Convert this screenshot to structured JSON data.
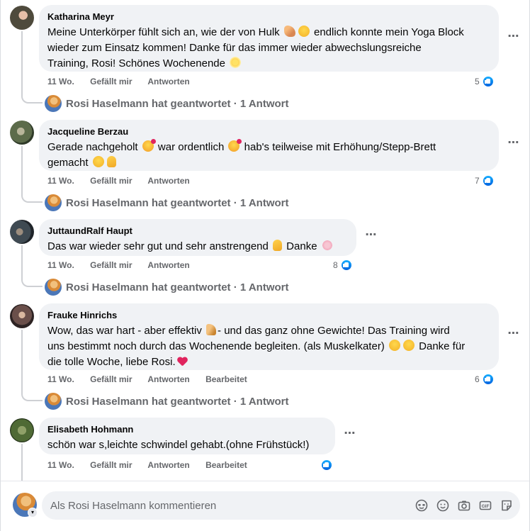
{
  "comments": [
    {
      "author": "Katharina Meyr",
      "text_lines": [
        [
          "Meine Unterkörper fühlt sich an, wie der von Hulk ",
          "arm",
          "face",
          " endlich konnte mein Yoga Block"
        ],
        [
          "wieder zum Einsatz kommen! Danke für das immer wieder abwechslungsreiche"
        ],
        [
          "Training, Rosi! Schönes Wochenende ",
          "sun"
        ]
      ],
      "time": "11 Wo.",
      "like_label": "Gefällt mir",
      "reply_label": "Antworten",
      "edited_label": "",
      "likes": "5",
      "reply_summary": "Rosi Haselmann hat geantwortet · 1 Antwort"
    },
    {
      "author": "Jacqueline Berzau",
      "text_lines": [
        [
          "Gerade nachgeholt ",
          "love",
          " war ordentlich ",
          "love",
          " hab's teilweise mit Erhöhung/Stepp-Brett"
        ],
        [
          "gemacht ",
          "face",
          "thumb"
        ]
      ],
      "time": "11 Wo.",
      "like_label": "Gefällt mir",
      "reply_label": "Antworten",
      "edited_label": "",
      "likes": "7",
      "reply_summary": "Rosi Haselmann hat geantwortet · 1 Antwort"
    },
    {
      "author": "JuttaundRalf Haupt",
      "text_lines": [
        [
          "Das war wieder sehr gut und sehr anstrengend ",
          "thumb",
          " Danke ",
          "flower"
        ]
      ],
      "time": "11 Wo.",
      "like_label": "Gefällt mir",
      "reply_label": "Antworten",
      "edited_label": "",
      "likes": "8",
      "reply_summary": "Rosi Haselmann hat geantwortet · 1 Antwort"
    },
    {
      "author": "Frauke Hinrichs",
      "text_lines": [
        [
          "Wow, das war hart - aber effektiv ",
          "leg",
          "- und das ganz ohne Gewichte! Das Training wird"
        ],
        [
          "uns bestimmt noch durch das Wochenende begleiten. (als Muskelkater) ",
          "face",
          "face",
          " Danke für"
        ],
        [
          "die tolle Woche, liebe Rosi.",
          "heart"
        ]
      ],
      "time": "11 Wo.",
      "like_label": "Gefällt mir",
      "reply_label": "Antworten",
      "edited_label": "Bearbeitet",
      "likes": "6",
      "reply_summary": "Rosi Haselmann hat geantwortet · 1 Antwort"
    },
    {
      "author": "Elisabeth Hohmann",
      "text_lines": [
        [
          "schön war s,leichte schwindel gehabt.(ohne Frühstück!)"
        ]
      ],
      "time": "11 Wo.",
      "like_label": "Gefällt mir",
      "reply_label": "Antworten",
      "edited_label": "Bearbeitet",
      "likes": "",
      "reply_summary": ""
    }
  ],
  "composer": {
    "placeholder": "Als Rosi Haselmann kommentieren",
    "tools": [
      "avatar-sticker-icon",
      "emoji-icon",
      "camera-icon",
      "gif-icon",
      "sticker-icon"
    ]
  },
  "colors": {
    "bubble": "#f0f2f5",
    "meta_text": "#65676b",
    "like_blue": "#0866ff"
  }
}
